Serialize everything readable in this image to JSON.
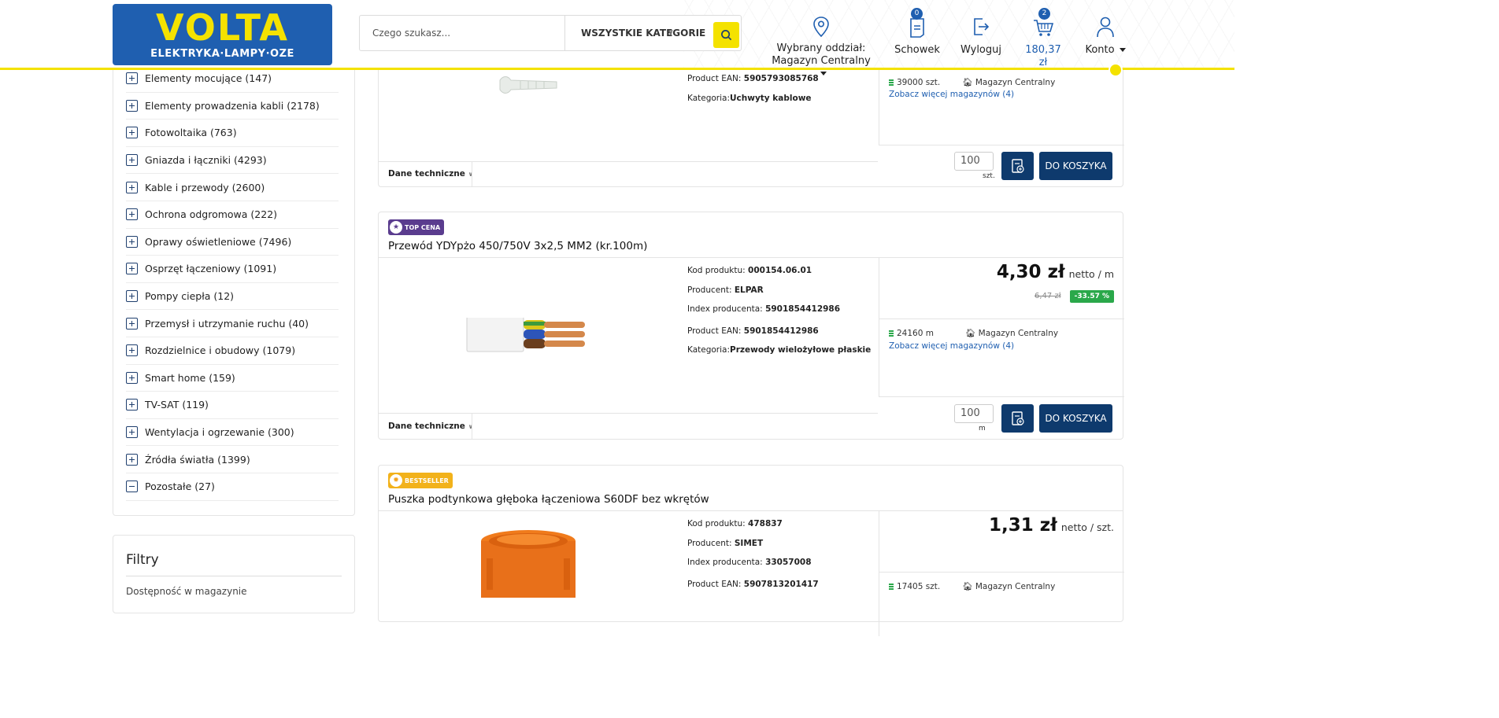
{
  "header": {
    "logo_main": "VOLTA",
    "logo_sub": "ELEKTRYKA·LAMPY·OZE",
    "search_placeholder": "Czego szukasz...",
    "category_select": "WSZYSTKIE KATEGORIE",
    "branch_label_1": "Wybrany oddział:",
    "branch_label_2": "Magazyn Centralny",
    "clipboard_label": "Schowek",
    "clipboard_count": "0",
    "logout_label": "Wyloguj",
    "cart_total": "180,37 zł",
    "cart_count": "2",
    "account_label": "Konto"
  },
  "sidebar": {
    "categories": [
      "Elementy mocujące (147)",
      "Elementy prowadzenia kabli (2178)",
      "Fotowoltaika (763)",
      "Gniazda i łączniki (4293)",
      "Kable i przewody (2600)",
      "Ochrona odgromowa (222)",
      "Oprawy oświetleniowe (7496)",
      "Osprzęt łączeniowy (1091)",
      "Pompy ciepła (12)",
      "Przemysł i utrzymanie ruchu (40)",
      "Rozdzielnice i obudowy (1079)",
      "Smart home (159)",
      "TV-SAT (119)",
      "Wentylacja i ogrzewanie (300)",
      "Źródła światła (1399)",
      "Pozostałe (27)"
    ],
    "filters_title": "Filtry",
    "filters_sub": "Dostępność w magazynie"
  },
  "products": [
    {
      "ean_label": "Product EAN:",
      "ean": "5905793085768",
      "cat_label": "Kategoria:",
      "category": "Uchwyty kablowe",
      "stock": "39000 szt.",
      "warehouse": "Magazyn Centralny",
      "more": "Zobacz więcej magazynów (4)",
      "tech": "Dane techniczne",
      "qty": "100",
      "qty_unit": "szt.",
      "cart": "DO KOSZYKA"
    },
    {
      "tag": "TOP CENA",
      "title": "Przewód YDYpżo 450/750V 3x2,5 MM2 (kr.100m)",
      "code_label": "Kod produktu:",
      "code": "000154.06.01",
      "producer_label": "Producent:",
      "producer": "ELPAR",
      "index_label": "Index producenta:",
      "index": "5901854412986",
      "ean_label": "Product EAN:",
      "ean": "5901854412986",
      "cat_label": "Kategoria:",
      "category": "Przewody wielożyłowe płaskie",
      "price": "4,30 zł",
      "price_unit": "netto / m",
      "old_price": "6,47 zł",
      "discount": "-33.57 %",
      "stock": "24160 m",
      "warehouse": "Magazyn Centralny",
      "more": "Zobacz więcej magazynów (4)",
      "tech": "Dane techniczne",
      "qty": "100",
      "qty_unit": "m",
      "cart": "DO KOSZYKA"
    },
    {
      "tag": "BESTSELLER",
      "title": "Puszka podtynkowa głęboka łączeniowa S60DF bez wkrętów",
      "code_label": "Kod produktu:",
      "code": "478837",
      "producer_label": "Producent:",
      "producer": "SIMET",
      "index_label": "Index producenta:",
      "index": "33057008",
      "ean_label": "Product EAN:",
      "ean": "5907813201417",
      "price": "1,31 zł",
      "price_unit": "netto / szt.",
      "stock": "17405 szt.",
      "warehouse": "Magazyn Centralny"
    }
  ],
  "colors": {
    "brand_blue": "#1f5fb0",
    "brand_yellow": "#f4e200",
    "button_navy": "#0e3a6d",
    "discount_green": "#2aa84a"
  }
}
